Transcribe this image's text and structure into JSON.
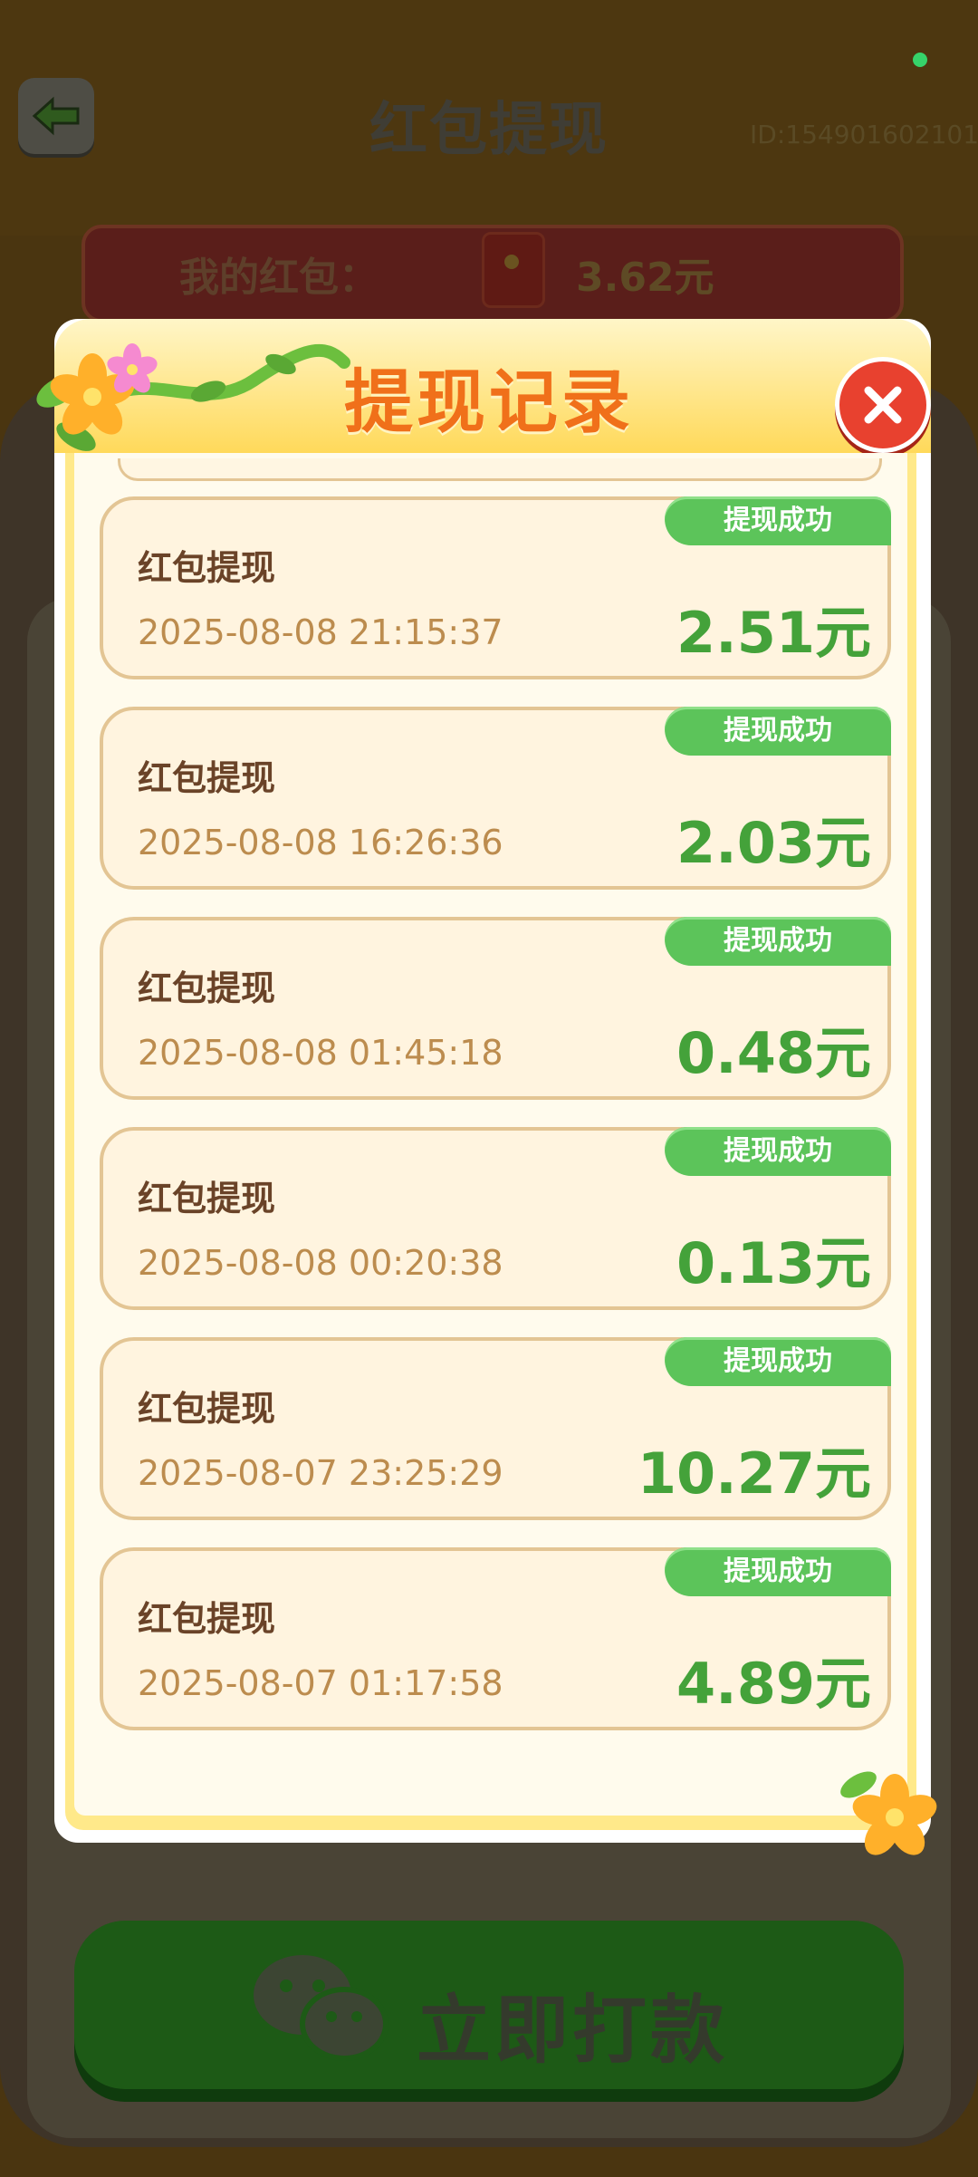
{
  "background": {
    "page_title": "红包提现",
    "user_id": "ID:154901602101",
    "wallet_label": "我的红包：",
    "wallet_amount": "3.62元",
    "pay_button_label": "立即打款"
  },
  "modal": {
    "title": "提现记录"
  },
  "records": [
    {
      "title": "红包提现",
      "time": "2025-08-08 21:15:37",
      "amount": "2.51元",
      "status": "提现成功"
    },
    {
      "title": "红包提现",
      "time": "2025-08-08 16:26:36",
      "amount": "2.03元",
      "status": "提现成功"
    },
    {
      "title": "红包提现",
      "time": "2025-08-08 01:45:18",
      "amount": "0.48元",
      "status": "提现成功"
    },
    {
      "title": "红包提现",
      "time": "2025-08-08 00:20:38",
      "amount": "0.13元",
      "status": "提现成功"
    },
    {
      "title": "红包提现",
      "time": "2025-08-07 23:25:29",
      "amount": "10.27元",
      "status": "提现成功"
    },
    {
      "title": "红包提现",
      "time": "2025-08-07 01:17:58",
      "amount": "4.89元",
      "status": "提现成功"
    }
  ],
  "colors": {
    "status_green": "#5cc45a",
    "amount_green": "#44a23a",
    "title_orange": "#f0701a",
    "close_red": "#e8412f"
  },
  "icons": [
    "back-arrow-icon",
    "red-envelope-icon",
    "close-icon",
    "wechat-icon",
    "flower-icon"
  ]
}
